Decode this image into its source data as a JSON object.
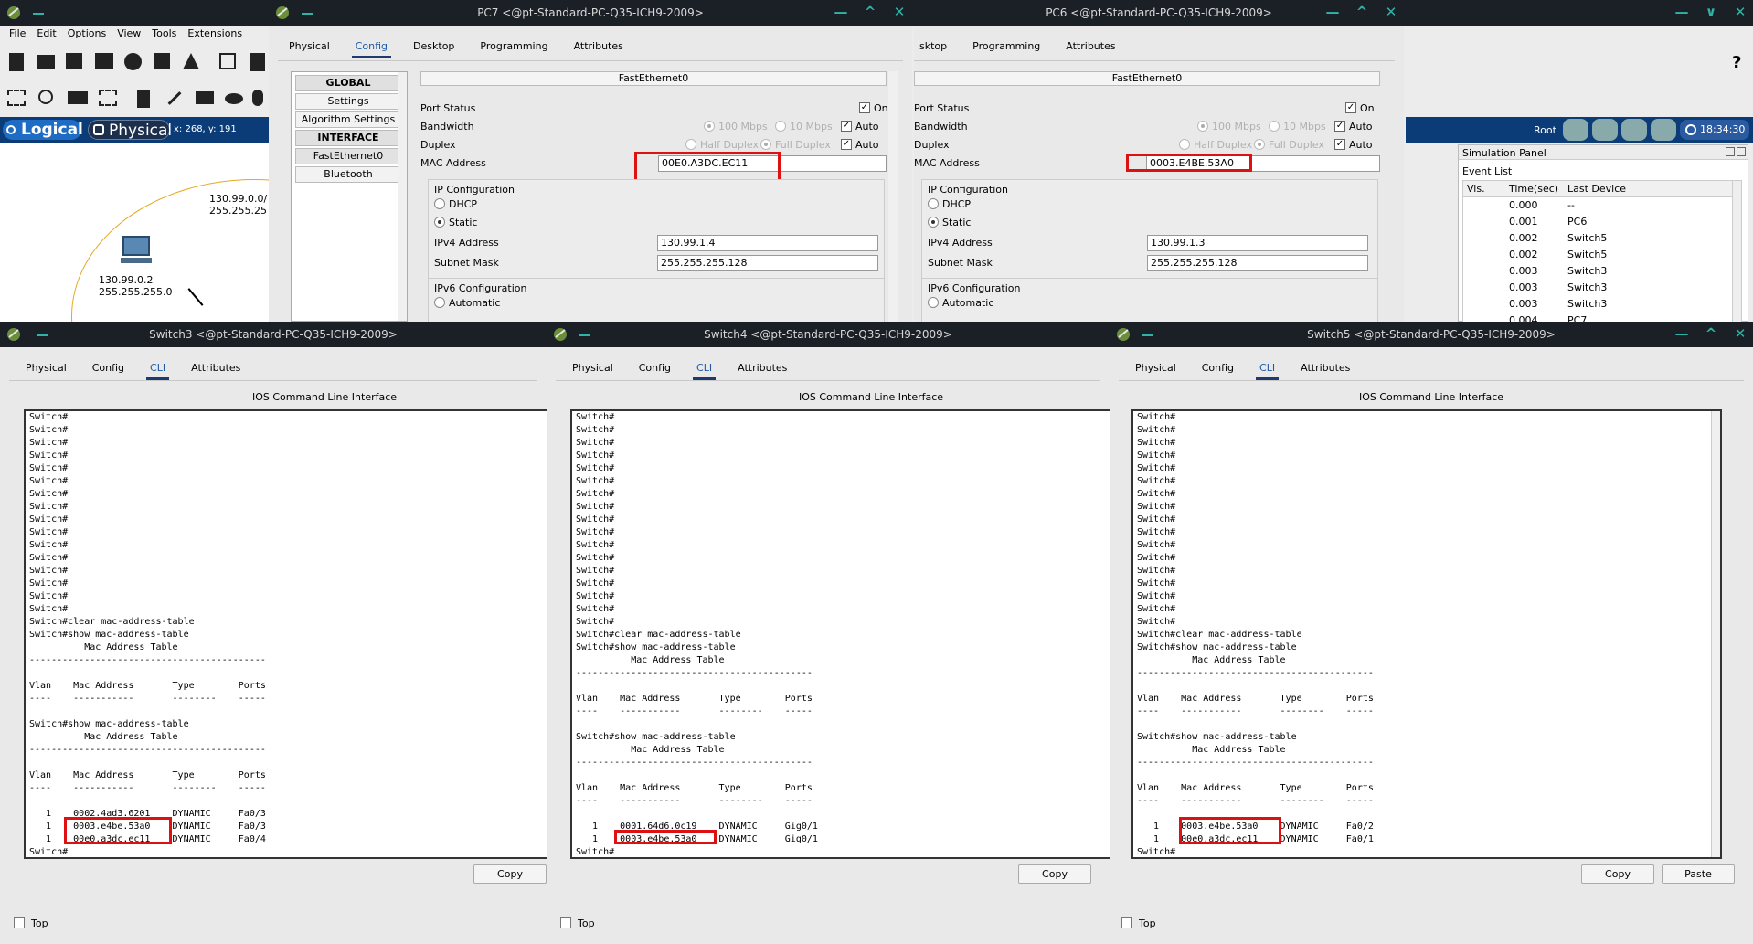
{
  "main": {
    "menu": [
      "File",
      "Edit",
      "Options",
      "View",
      "Tools",
      "Extensions"
    ],
    "logical_tab": "Logical",
    "physical_tab": "Physical",
    "coords": "x: 268, y: 191",
    "root_label": "Root",
    "clock": "18:34:30",
    "help_icon": "?",
    "network_label_1": "130.99.0.0/",
    "network_label_2": "255.255.25",
    "pc_ip": "130.99.0.2",
    "pc_mask": "255.255.255.0"
  },
  "sim": {
    "title": "Simulation Panel",
    "event_list": "Event List",
    "cols": [
      "Vis.",
      "Time(sec)",
      "Last Device"
    ],
    "rows": [
      {
        "time": "0.000",
        "device": "--"
      },
      {
        "time": "0.001",
        "device": "PC6"
      },
      {
        "time": "0.002",
        "device": "Switch5"
      },
      {
        "time": "0.002",
        "device": "Switch5"
      },
      {
        "time": "0.003",
        "device": "Switch3"
      },
      {
        "time": "0.003",
        "device": "Switch3"
      },
      {
        "time": "0.003",
        "device": "Switch3"
      },
      {
        "time": "0.004",
        "device": "PC7"
      }
    ]
  },
  "pc7": {
    "title": "PC7 <@pt-Standard-PC-Q35-ICH9-2009>",
    "tabs": [
      "Physical",
      "Config",
      "Desktop",
      "Programming",
      "Attributes"
    ],
    "side": {
      "global": "GLOBAL",
      "settings": "Settings",
      "algo": "Algorithm Settings",
      "interface": "INTERFACE",
      "fe": "FastEthernet0",
      "bt": "Bluetooth"
    },
    "iface_title": "FastEthernet0",
    "port_status": "Port Status",
    "on": "On",
    "bandwidth": "Bandwidth",
    "mbps100": "100 Mbps",
    "mbps10": "10 Mbps",
    "auto": "Auto",
    "duplex": "Duplex",
    "half": "Half Duplex",
    "full": "Full Duplex",
    "mac_label": "MAC Address",
    "mac": "00E0.A3DC.EC11",
    "ipconf": "IP Configuration",
    "dhcp": "DHCP",
    "static": "Static",
    "ipv4_label": "IPv4 Address",
    "ipv4": "130.99.1.4",
    "mask_label": "Subnet Mask",
    "mask": "255.255.255.128",
    "ipv6conf": "IPv6 Configuration",
    "automatic": "Automatic"
  },
  "pc6": {
    "title": "PC6 <@pt-Standard-PC-Q35-ICH9-2009>",
    "tabs": [
      "sktop",
      "Programming",
      "Attributes"
    ],
    "iface_title": "FastEthernet0",
    "port_status": "Port Status",
    "on": "On",
    "bandwidth": "Bandwidth",
    "mbps100": "100 Mbps",
    "mbps10": "10 Mbps",
    "auto": "Auto",
    "duplex": "Duplex",
    "half": "Half Duplex",
    "full": "Full Duplex",
    "mac_label": "MAC Address",
    "mac": "0003.E4BE.53A0",
    "ipconf": "IP Configuration",
    "dhcp": "DHCP",
    "static": "Static",
    "ipv4_label": "IPv4 Address",
    "ipv4": "130.99.1.3",
    "mask_label": "Subnet Mask",
    "mask": "255.255.255.128",
    "ipv6conf": "IPv6 Configuration",
    "automatic": "Automatic"
  },
  "switch3": {
    "title": "Switch3 <@pt-Standard-PC-Q35-ICH9-2009>",
    "tabs": [
      "Physical",
      "Config",
      "CLI",
      "Attributes"
    ],
    "cli_title": "IOS Command Line Interface",
    "terminal": "Switch#\nSwitch#\nSwitch#\nSwitch#\nSwitch#\nSwitch#\nSwitch#\nSwitch#\nSwitch#\nSwitch#\nSwitch#\nSwitch#\nSwitch#\nSwitch#\nSwitch#\nSwitch#\nSwitch#clear mac-address-table\nSwitch#show mac-address-table\n          Mac Address Table\n-------------------------------------------\n\nVlan    Mac Address       Type        Ports\n----    -----------       --------    -----\n\nSwitch#show mac-address-table\n          Mac Address Table\n-------------------------------------------\n\nVlan    Mac Address       Type        Ports\n----    -----------       --------    -----\n\n   1    0002.4ad3.6201    DYNAMIC     Fa0/3\n   1    0003.e4be.53a0    DYNAMIC     Fa0/3\n   1    00e0.a3dc.ec11    DYNAMIC     Fa0/4\nSwitch#",
    "copy": "Copy",
    "top": "Top"
  },
  "switch4": {
    "title": "Switch4 <@pt-Standard-PC-Q35-ICH9-2009>",
    "tabs": [
      "Physical",
      "Config",
      "CLI",
      "Attributes"
    ],
    "cli_title": "IOS Command Line Interface",
    "terminal": "Switch#\nSwitch#\nSwitch#\nSwitch#\nSwitch#\nSwitch#\nSwitch#\nSwitch#\nSwitch#\nSwitch#\nSwitch#\nSwitch#\nSwitch#\nSwitch#\nSwitch#\nSwitch#\nSwitch#\nSwitch#clear mac-address-table\nSwitch#show mac-address-table\n          Mac Address Table\n-------------------------------------------\n\nVlan    Mac Address       Type        Ports\n----    -----------       --------    -----\n\nSwitch#show mac-address-table\n          Mac Address Table\n-------------------------------------------\n\nVlan    Mac Address       Type        Ports\n----    -----------       --------    -----\n\n   1    0001.64d6.0c19    DYNAMIC     Gig0/1\n   1    0003.e4be.53a0    DYNAMIC     Gig0/1\nSwitch#",
    "copy": "Copy",
    "top": "Top"
  },
  "switch5": {
    "title": "Switch5 <@pt-Standard-PC-Q35-ICH9-2009>",
    "tabs": [
      "Physical",
      "Config",
      "CLI",
      "Attributes"
    ],
    "cli_title": "IOS Command Line Interface",
    "terminal": "Switch#\nSwitch#\nSwitch#\nSwitch#\nSwitch#\nSwitch#\nSwitch#\nSwitch#\nSwitch#\nSwitch#\nSwitch#\nSwitch#\nSwitch#\nSwitch#\nSwitch#\nSwitch#\nSwitch#\nSwitch#clear mac-address-table\nSwitch#show mac-address-table\n          Mac Address Table\n-------------------------------------------\n\nVlan    Mac Address       Type        Ports\n----    -----------       --------    -----\n\nSwitch#show mac-address-table\n          Mac Address Table\n-------------------------------------------\n\nVlan    Mac Address       Type        Ports\n----    -----------       --------    -----\n\n   1    0003.e4be.53a0    DYNAMIC     Fa0/2\n   1    00e0.a3dc.ec11    DYNAMIC     Fa0/1\nSwitch#",
    "copy": "Copy",
    "paste": "Paste",
    "top": "Top"
  }
}
